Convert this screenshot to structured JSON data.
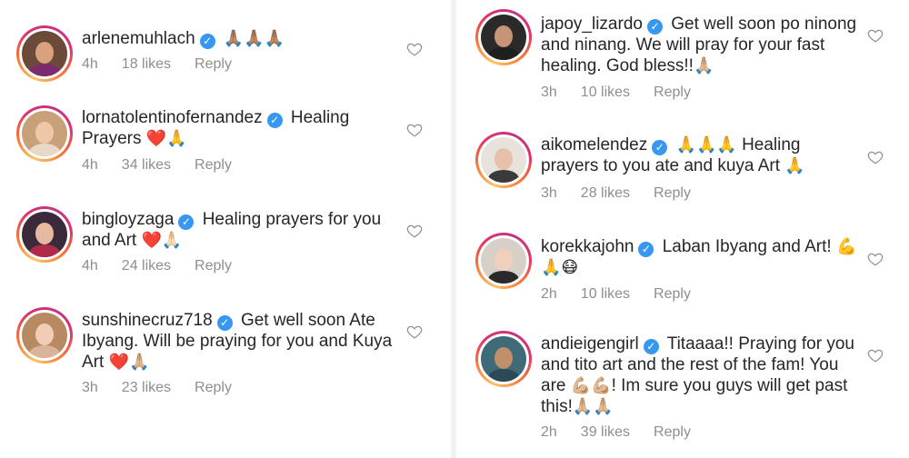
{
  "left_comments": [
    {
      "username": "arlenemuhlach",
      "text": "",
      "emoji": "🙏🏽🙏🏽🙏🏽",
      "time": "4h",
      "likes": "18 likes",
      "reply": "Reply"
    },
    {
      "username": "lornatolentinofernandez",
      "text": "Healing Prayers",
      "emoji": "❤️🙏",
      "time": "4h",
      "likes": "34 likes",
      "reply": "Reply"
    },
    {
      "username": "bingloyzaga",
      "text": "Healing prayers for you and Art",
      "emoji": "❤️🙏🏻",
      "time": "4h",
      "likes": "24 likes",
      "reply": "Reply"
    },
    {
      "username": "sunshinecruz718",
      "text": "Get well soon Ate Ibyang. Will be praying for you and Kuya Art",
      "emoji": "❤️🙏🏼",
      "time": "3h",
      "likes": "23 likes",
      "reply": "Reply"
    }
  ],
  "right_comments": [
    {
      "username": "japoy_lizardo",
      "text": "Get well soon po ninong and ninang. We will pray for your fast healing. God bless!!",
      "emoji": "🙏🏼",
      "time": "3h",
      "likes": "10 likes",
      "reply": "Reply"
    },
    {
      "username": "aikomelendez",
      "text_before": "",
      "emoji_before": "🙏🙏🙏",
      "text": "Healing prayers to you ate and kuya Art",
      "emoji": "🙏",
      "time": "3h",
      "likes": "28 likes",
      "reply": "Reply"
    },
    {
      "username": "korekkajohn",
      "text": "Laban Ibyang and Art!",
      "emoji": "💪🙏😷",
      "time": "2h",
      "likes": "10 likes",
      "reply": "Reply"
    },
    {
      "username": "andieigengirl",
      "text": "Titaaaa!! Praying for you and tito art and the rest of the fam! You are",
      "emoji_mid": "💪🏼💪🏼",
      "text_after": "! Im sure you guys will get past this!",
      "emoji": "🙏🏼🙏🏼",
      "time": "2h",
      "likes": "39 likes",
      "reply": "Reply"
    }
  ],
  "colors": {
    "verified": "#3897f0",
    "meta": "#8e8e8e",
    "text": "#262626",
    "heart_red": "#ed4956"
  },
  "icons": {
    "verified": "verified-badge-icon",
    "like": "heart-outline-icon"
  }
}
